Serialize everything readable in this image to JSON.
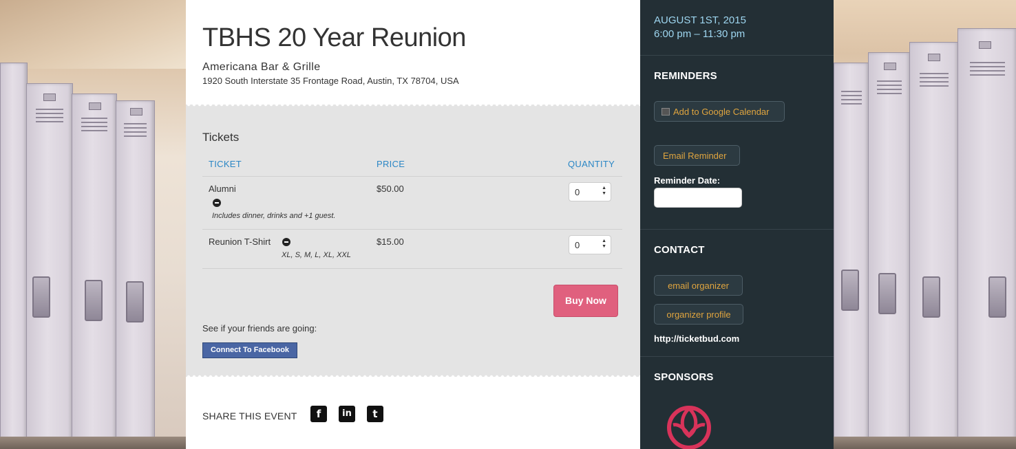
{
  "event": {
    "title": "TBHS 20 Year Reunion",
    "venue_name": "Americana Bar & Grille",
    "venue_address": "1920 South Interstate 35 Frontage Road, Austin, TX 78704, USA"
  },
  "tickets": {
    "heading": "Tickets",
    "columns": [
      "TICKET",
      "PRICE",
      "QUANTITY"
    ],
    "rows": [
      {
        "name": "Alumni",
        "description": "Includes dinner, drinks and +1 guest.",
        "price": "$50.00",
        "quantity": "0"
      },
      {
        "name": "Reunion T-Shirt",
        "description": "XL, S, M, L, XL, XXL",
        "price": "$15.00",
        "quantity": "0"
      }
    ],
    "buy_label": "Buy Now",
    "friends_text": "See if your friends are going:",
    "facebook_label": "Connect To Facebook"
  },
  "share": {
    "label": "SHARE THIS EVENT",
    "icons": [
      "facebook-icon",
      "linkedin-icon",
      "twitter-icon"
    ],
    "glyphs": [
      "f",
      "in",
      "t"
    ]
  },
  "sidebar": {
    "date": "AUGUST 1ST, 2015",
    "time": "6:00 pm – 11:30 pm",
    "reminders_title": "REMINDERS",
    "google_calendar_label": "Add to Google Calendar",
    "email_reminder_label": "Email Reminder",
    "reminder_date_label": "Reminder Date:",
    "reminder_date_value": "",
    "contact_title": "CONTACT",
    "email_organizer_label": "email organizer",
    "organizer_profile_label": "organizer profile",
    "website": "http://ticketbud.com",
    "sponsors_title": "SPONSORS"
  },
  "colors": {
    "sidebar_bg": "#232f35",
    "date_text": "#9ed6f0",
    "button_text": "#e0a53f",
    "buy_button": "#e0607e",
    "link_blue": "#2a86c5",
    "facebook_blue": "#4a66a4",
    "sponsor_red": "#d8335a"
  }
}
